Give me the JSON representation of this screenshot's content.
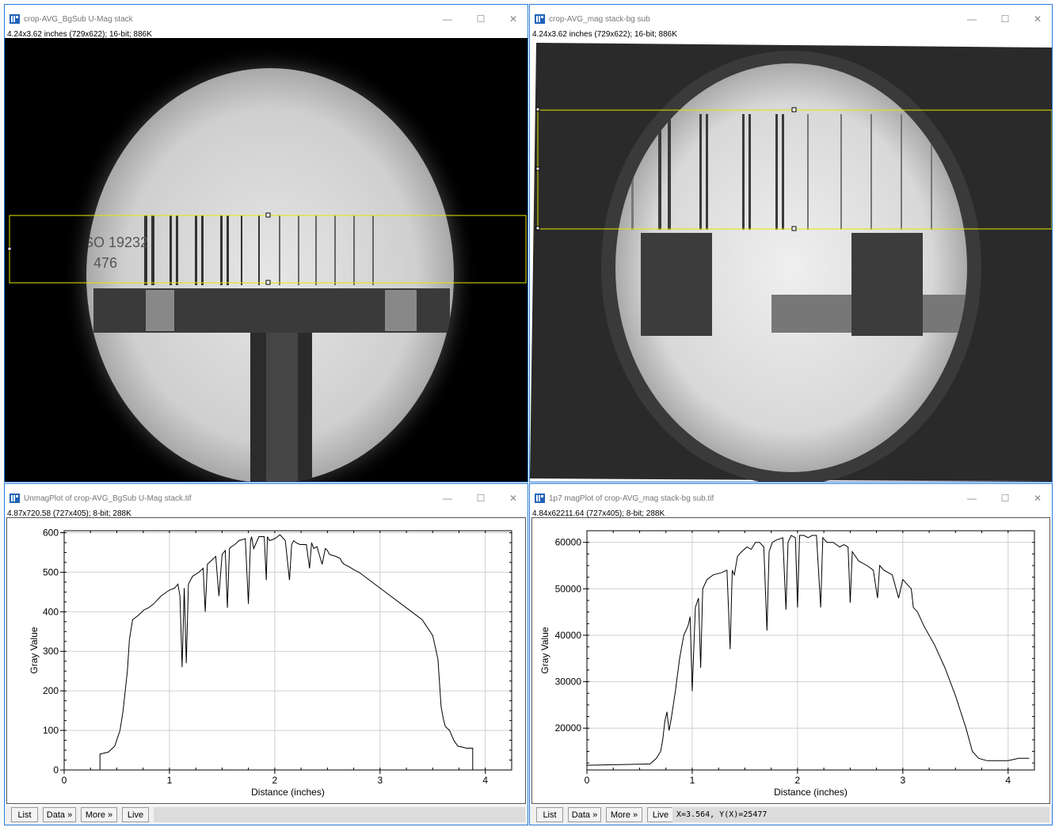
{
  "windows": {
    "w1": {
      "title": "crop-AVG_BgSub U-Mag stack",
      "info": "4.24x3.62 inches (729x622); 16-bit; 886K"
    },
    "w2": {
      "title": "crop-AVG_mag stack-bg sub",
      "info": "4.24x3.62 inches (729x622); 16-bit; 886K"
    },
    "w3": {
      "title": "UnmagPlot of crop-AVG_BgSub U-Mag stack.tif",
      "info": "4.87x720.58  (727x405); 8-bit; 288K",
      "status": ""
    },
    "w4": {
      "title": "1p7 magPlot of crop-AVG_mag stack-bg sub.tif",
      "info": "4.84x62211.64  (727x405); 8-bit; 288K",
      "status": "X=3.564, Y(X)=25477"
    }
  },
  "controls": {
    "minimize": "—",
    "maximize": "☐",
    "close": "✕"
  },
  "buttons": {
    "list": "List",
    "data": "Data »",
    "more": "More »",
    "live": "Live"
  },
  "image_labels": {
    "iso": "SO 19232",
    "num": "476"
  },
  "chart_data": [
    {
      "type": "line",
      "xlabel": "Distance (inches)",
      "ylabel": "Gray Value",
      "xlim": [
        0,
        4.25
      ],
      "ylim": [
        0,
        605
      ],
      "xticks": [
        0,
        1,
        2,
        3,
        4
      ],
      "yticks": [
        0,
        100,
        200,
        300,
        400,
        500,
        600
      ],
      "grid": true,
      "series": [
        {
          "x": [
            0.34,
            0.34,
            0.37,
            0.42,
            0.48,
            0.53,
            0.56,
            0.6,
            0.62,
            0.65,
            0.7,
            0.76,
            0.8,
            0.85,
            0.92,
            1.0,
            1.05,
            1.08,
            1.1,
            1.12,
            1.14,
            1.16,
            1.18,
            1.2,
            1.22,
            1.28,
            1.32,
            1.34,
            1.36,
            1.4,
            1.44,
            1.47,
            1.5,
            1.53,
            1.55,
            1.57,
            1.59,
            1.62,
            1.66,
            1.72,
            1.75,
            1.77,
            1.78,
            1.8,
            1.85,
            1.9,
            1.92,
            1.93,
            1.95,
            2.0,
            2.05,
            2.1,
            2.14,
            2.16,
            2.18,
            2.2,
            2.24,
            2.3,
            2.33,
            2.35,
            2.37,
            2.4,
            2.45,
            2.48,
            2.5,
            2.52,
            2.58,
            2.62,
            2.64,
            2.66,
            2.7,
            2.76,
            2.8,
            2.9,
            3.0,
            3.1,
            3.2,
            3.3,
            3.4,
            3.5,
            3.55,
            3.58,
            3.6,
            3.62,
            3.66,
            3.7,
            3.74,
            3.78,
            3.82,
            3.88,
            3.88
          ],
          "y": [
            0,
            40,
            42,
            45,
            60,
            100,
            150,
            250,
            330,
            380,
            390,
            405,
            410,
            420,
            440,
            455,
            460,
            470,
            440,
            260,
            460,
            270,
            470,
            480,
            490,
            500,
            510,
            400,
            520,
            530,
            540,
            440,
            545,
            555,
            410,
            560,
            565,
            570,
            580,
            585,
            420,
            580,
            590,
            560,
            590,
            590,
            480,
            590,
            580,
            585,
            595,
            580,
            480,
            570,
            580,
            575,
            570,
            570,
            510,
            575,
            560,
            565,
            520,
            560,
            555,
            545,
            540,
            535,
            525,
            520,
            515,
            505,
            500,
            480,
            460,
            440,
            420,
            400,
            380,
            340,
            280,
            160,
            130,
            110,
            100,
            75,
            60,
            58,
            55,
            55,
            0
          ]
        }
      ]
    },
    {
      "type": "line",
      "xlabel": "Distance (inches)",
      "ylabel": "Gray Value",
      "xlim": [
        0,
        4.25
      ],
      "ylim": [
        11000,
        62500
      ],
      "xticks": [
        0,
        1,
        2,
        3,
        4
      ],
      "yticks": [
        20000,
        30000,
        40000,
        50000,
        60000
      ],
      "grid": true,
      "series": [
        {
          "x": [
            0,
            0.2,
            0.4,
            0.6,
            0.66,
            0.7,
            0.72,
            0.74,
            0.76,
            0.78,
            0.8,
            0.84,
            0.88,
            0.92,
            0.96,
            0.98,
            1.0,
            1.03,
            1.06,
            1.08,
            1.1,
            1.14,
            1.2,
            1.28,
            1.33,
            1.36,
            1.38,
            1.4,
            1.43,
            1.47,
            1.52,
            1.56,
            1.6,
            1.64,
            1.68,
            1.71,
            1.73,
            1.76,
            1.8,
            1.86,
            1.89,
            1.91,
            1.94,
            1.98,
            2.0,
            2.02,
            2.06,
            2.1,
            2.14,
            2.18,
            2.22,
            2.24,
            2.28,
            2.34,
            2.4,
            2.44,
            2.48,
            2.5,
            2.52,
            2.58,
            2.66,
            2.72,
            2.76,
            2.78,
            2.82,
            2.9,
            2.96,
            3.0,
            3.04,
            3.08,
            3.1,
            3.14,
            3.2,
            3.3,
            3.4,
            3.5,
            3.6,
            3.66,
            3.72,
            3.8,
            3.9,
            4.0,
            4.1,
            4.2
          ],
          "y": [
            12000,
            12100,
            12200,
            12300,
            13500,
            15000,
            17500,
            21500,
            23500,
            19500,
            22000,
            28000,
            35000,
            40000,
            42000,
            44000,
            28000,
            46000,
            48000,
            33000,
            50000,
            52000,
            53000,
            53500,
            54000,
            37000,
            54000,
            53000,
            57000,
            58000,
            59000,
            58500,
            60000,
            60000,
            59000,
            41000,
            58000,
            60000,
            60500,
            61000,
            45500,
            60000,
            61500,
            61000,
            46000,
            61500,
            61500,
            61000,
            61500,
            61500,
            46000,
            61000,
            60000,
            60000,
            59000,
            59500,
            59000,
            47000,
            58000,
            56000,
            55000,
            54000,
            48000,
            55000,
            54000,
            53000,
            48000,
            52000,
            51000,
            50000,
            46000,
            45000,
            42000,
            38000,
            33000,
            27000,
            20000,
            15000,
            13500,
            13000,
            13000,
            13000,
            13500,
            13500
          ]
        }
      ]
    }
  ]
}
